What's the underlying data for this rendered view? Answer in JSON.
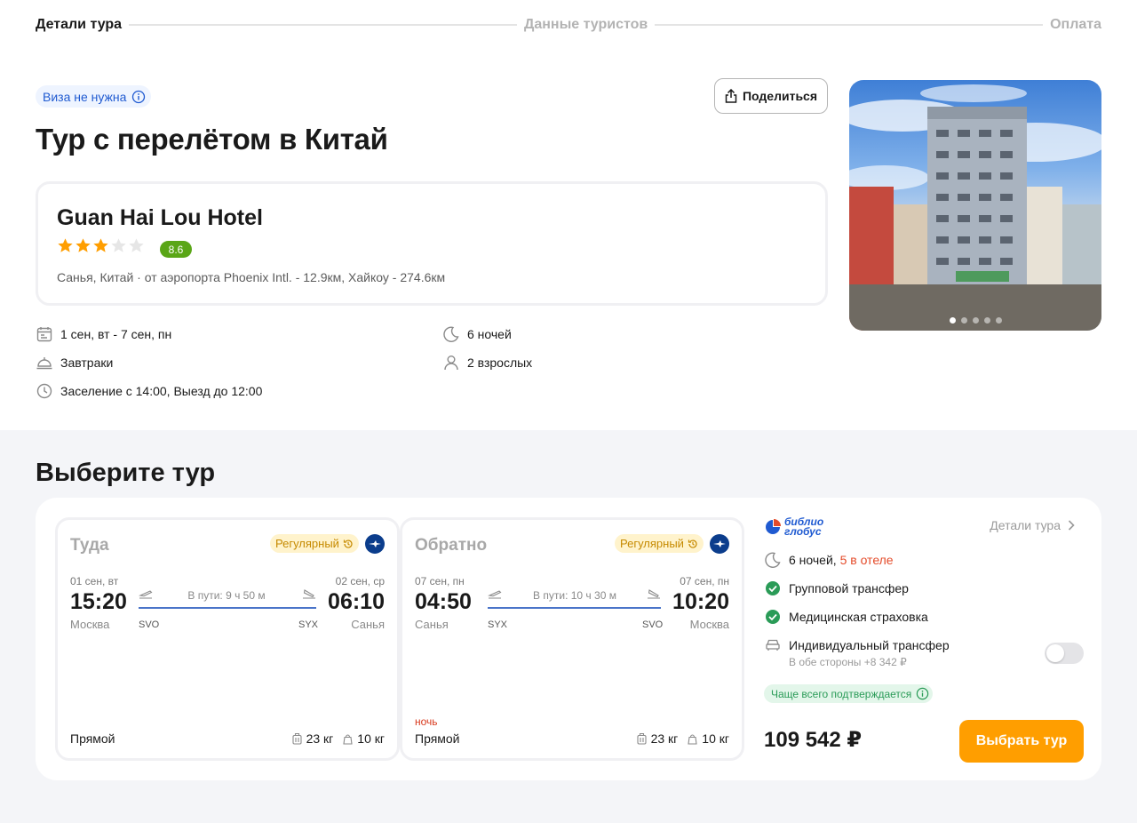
{
  "stepper": {
    "steps": [
      "Детали тура",
      "Данные туристов",
      "Оплата"
    ]
  },
  "header": {
    "visa_badge": "Виза не нужна",
    "share_label": "Поделиться",
    "title": "Тур с перелётом в Китай"
  },
  "hotel": {
    "name": "Guan Hai Lou Hotel",
    "stars": 3,
    "stars_max": 5,
    "rating": "8.6",
    "location": "Санья, Китай · от аэропорта Phoenix Intl. - 12.9км, Хайкоу - 274.6км",
    "photo_count": 5,
    "photo_active_index": 0
  },
  "facts": {
    "dates": "1 сен, вт - 7 сен, пн",
    "nights": "6 ночей",
    "meals": "Завтраки",
    "guests": "2 взрослых",
    "checkin": "Заселение с 14:00, Выезд до 12:00"
  },
  "choose": {
    "title": "Выберите тур"
  },
  "flights": [
    {
      "direction": "Туда",
      "regular": "Регулярный",
      "dep_date": "01 сен, вт",
      "dep_time": "15:20",
      "dep_city": "Москва",
      "dep_code": "SVO",
      "duration": "В пути: 9 ч 50 м",
      "arr_date": "02 сен, ср",
      "arr_time": "06:10",
      "arr_city": "Санья",
      "arr_code": "SYX",
      "night": "",
      "type": "Прямой",
      "baggage": "23 кг",
      "hand_luggage": "10 кг"
    },
    {
      "direction": "Обратно",
      "regular": "Регулярный",
      "dep_date": "07 сен, пн",
      "dep_time": "04:50",
      "dep_city": "Санья",
      "dep_code": "SYX",
      "duration": "В пути: 10 ч 30 м",
      "arr_date": "07 сен, пн",
      "arr_time": "10:20",
      "arr_city": "Москва",
      "arr_code": "SVO",
      "night": "ночь",
      "type": "Прямой",
      "baggage": "23 кг",
      "hand_luggage": "10 кг"
    }
  ],
  "summary": {
    "operator_line1": "библио",
    "operator_line2": "глобус",
    "details_link": "Детали тура",
    "nights": "6 ночей,",
    "nights_hotel": "5 в отеле",
    "group_transfer": "Групповой трансфер",
    "insurance": "Медицинская страховка",
    "individual_transfer": "Индивидуальный трансфер",
    "individual_transfer_note": "В обе стороны +8 342 ₽",
    "individual_transfer_enabled": false,
    "confirm_badge": "Чаще всего подтверждается",
    "price": "109 542 ₽",
    "choose_button": "Выбрать тур"
  },
  "colors": {
    "accent_orange": "#ff9e00",
    "link_blue": "#1f5ad1",
    "rating_green": "#5aa617",
    "star_orange": "#ff9e00",
    "check_green": "#2a9b57"
  },
  "icons": {
    "calendar": "calendar-icon",
    "moon": "moon-icon",
    "meals": "cloche-icon",
    "person": "person-icon",
    "clock": "clock-icon",
    "check": "check-circle-icon",
    "car": "car-icon",
    "share": "share-icon",
    "info": "info-icon",
    "chevron": "chevron-right-icon"
  }
}
